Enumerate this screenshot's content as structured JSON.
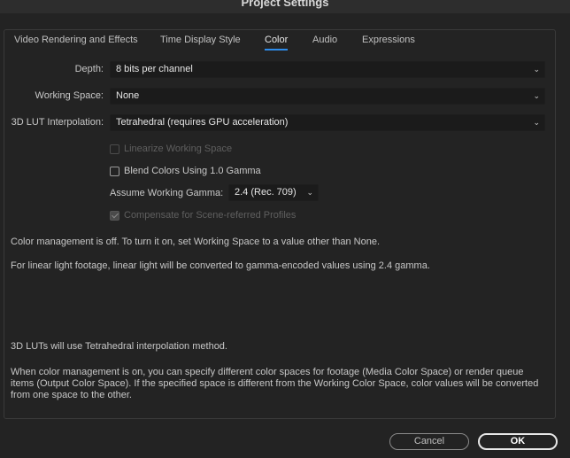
{
  "window": {
    "title": "Project Settings"
  },
  "tabs": [
    {
      "label": "Video Rendering and Effects"
    },
    {
      "label": "Time Display Style"
    },
    {
      "label": "Color",
      "active": true
    },
    {
      "label": "Audio"
    },
    {
      "label": "Expressions"
    }
  ],
  "color": {
    "depth": {
      "label": "Depth:",
      "value": "8 bits per channel"
    },
    "working_space": {
      "label": "Working Space:",
      "value": "None"
    },
    "lut_interpolation": {
      "label": "3D LUT Interpolation:",
      "value": "Tetrahedral (requires GPU acceleration)"
    },
    "linearize": {
      "label": "Linearize Working Space",
      "checked": false,
      "enabled": false
    },
    "blend_gamma": {
      "label": "Blend Colors Using 1.0 Gamma",
      "checked": false,
      "enabled": true
    },
    "assume_gamma": {
      "label": "Assume Working Gamma:",
      "value": "2.4 (Rec. 709)"
    },
    "compensate": {
      "label": "Compensate for Scene-referred Profiles",
      "checked": true,
      "enabled": false
    }
  },
  "info": {
    "line1": "Color management is off. To turn it on, set Working Space to a value other than None.",
    "line2": "For linear light footage, linear light will be converted to gamma-encoded values using 2.4 gamma.",
    "line3": "3D LUTs will use Tetrahedral interpolation method.",
    "line4": "When color management is on, you can specify different color spaces for footage (Media Color Space) or render queue items (Output Color Space). If the specified space is different from the Working Color Space, color values will be converted from one space to the other."
  },
  "buttons": {
    "cancel": "Cancel",
    "ok": "OK"
  },
  "colors": {
    "accent": "#2d8ceb",
    "background": "#232323",
    "field": "#1b1b1b"
  }
}
